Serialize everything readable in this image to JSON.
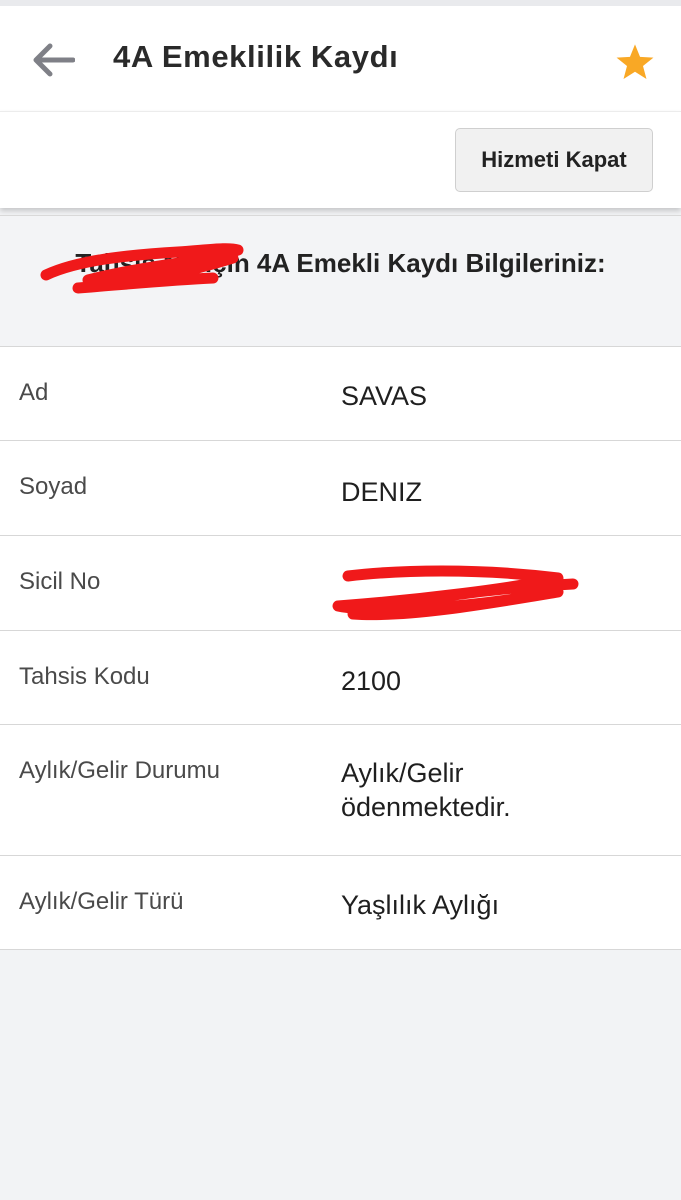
{
  "header": {
    "title": "4A Emeklilik Kaydı",
    "back_icon": "arrow-left-icon",
    "favorite_icon": "star-icon",
    "favorite_color": "#f9a825"
  },
  "actions": {
    "close_service_label": "Hizmeti Kapat"
  },
  "info": {
    "title_text": "Tahsis No için 4A Emekli Kaydı Bilgileriniz:",
    "redaction_color": "#f0191a"
  },
  "details": [
    {
      "label": "Ad",
      "value": "SAVAS"
    },
    {
      "label": "Soyad",
      "value": "DENIZ"
    },
    {
      "label": "Sicil No",
      "value": ""
    },
    {
      "label": "Tahsis Kodu",
      "value": "2100"
    },
    {
      "label": "Aylık/Gelir Durumu",
      "value": "Aylık/Gelir ödenmektedir."
    },
    {
      "label": "Aylık/Gelir Türü",
      "value": "Yaşlılık Aylığı"
    }
  ]
}
